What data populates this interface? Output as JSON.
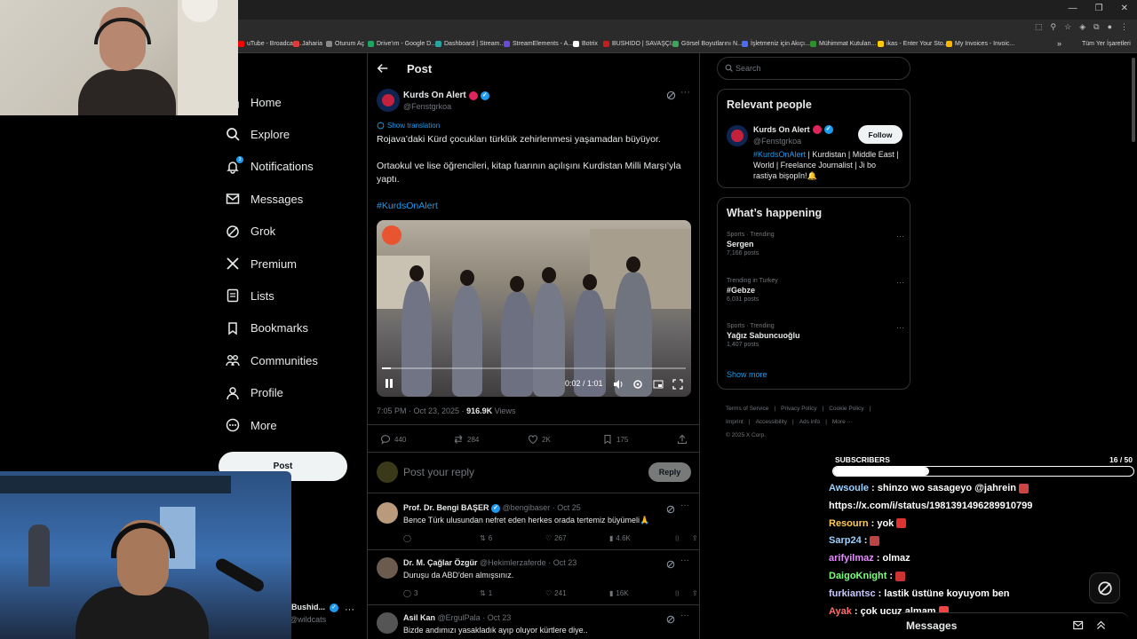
{
  "browser": {
    "bookmarks": [
      {
        "label": "uTube - Broadcas...",
        "color": "#ff0000"
      },
      {
        "label": "Jaharia",
        "color": "#e23a3a"
      },
      {
        "label": "Oturum Aç",
        "color": "#888888"
      },
      {
        "label": "Drive'ım - Google D...",
        "color": "#1fa463"
      },
      {
        "label": "Dashboard | Stream...",
        "color": "#2aa3a3"
      },
      {
        "label": "StreamElements - A...",
        "color": "#6c4bd8"
      },
      {
        "label": "Botrix",
        "color": "#ffffff"
      },
      {
        "label": "BUSHIDO | SAVAŞÇI...",
        "color": "#c81d1d"
      },
      {
        "label": "Görsel Boyutlarını N...",
        "color": "#3ba55c"
      },
      {
        "label": "İşletmeniz için Akıçı...",
        "color": "#4a6cf7"
      },
      {
        "label": "Mühimmat Kutuları...",
        "color": "#2f8f2f"
      },
      {
        "label": "ikas - Enter Your Sto...",
        "color": "#ffcc00"
      },
      {
        "label": "My Invoices - Invoic...",
        "color": "#ffb400"
      }
    ],
    "all_bookmarks": "Tüm Yer İşaretleri"
  },
  "nav": {
    "items": [
      {
        "label": "Home",
        "icon": "home-icon"
      },
      {
        "label": "Explore",
        "icon": "search-icon"
      },
      {
        "label": "Notifications",
        "icon": "bell-icon"
      },
      {
        "label": "Messages",
        "icon": "envelope-icon"
      },
      {
        "label": "Grok",
        "icon": "grok-icon"
      },
      {
        "label": "Premium",
        "icon": "x-logo-icon"
      },
      {
        "label": "Lists",
        "icon": "list-icon"
      },
      {
        "label": "Bookmarks",
        "icon": "bookmark-icon"
      },
      {
        "label": "Communities",
        "icon": "people-icon"
      },
      {
        "label": "Profile",
        "icon": "person-icon"
      },
      {
        "label": "More",
        "icon": "more-circle-icon"
      }
    ],
    "notifications_badge": "3",
    "post_button": "Post",
    "account_name": "Bushid...",
    "account_handle": "@wildcats"
  },
  "post": {
    "header_title": "Post",
    "author_name": "Kurds On Alert",
    "author_handle": "@Fenstgrkoa",
    "show_translation": "Show translation",
    "text_line1": "Rojava’daki Kürd çocukları türklük zehirlenmesi yaşamadan büyüyor.",
    "text_line2": "Ortaokul ve lise öğrencileri, kitap fuarının açılışını Kurdistan Milli Marşı’yla yaptı.",
    "hashtag": "#KurdsOnAlert",
    "video_time": "0:02 / 1:01",
    "video_progress": 0.03,
    "meta_time": "7:05 PM · Oct 23, 2025 · ",
    "meta_views_count": "916.9K",
    "meta_views_label": " Views",
    "replies": "440",
    "reposts": "284",
    "likes": "2K",
    "bookmarks": "175",
    "reply_placeholder": "Post your reply",
    "reply_button": "Reply"
  },
  "replies": [
    {
      "name": "Prof. Dr. Bengi BAŞER",
      "handle": "@bengibaser · Oct 25",
      "text": "Bence Türk ulusundan nefret eden herkes orada tertemiz büyümeli🙏",
      "reposts": "6",
      "likes": "267",
      "views": "4.6K",
      "comments": "",
      "avatar_color": "#b99a7d"
    },
    {
      "name": "Dr. M. Çağlar Özgür",
      "handle": "@Hekimlerzaferde · Oct 23",
      "text": "Duruşu da ABD'den almışsınız.",
      "comments": "3",
      "reposts": "1",
      "likes": "241",
      "views": "16K",
      "avatar_color": "#6b5a4e"
    },
    {
      "name": "Asil Kan",
      "handle": "@ErgulPala · Oct 23",
      "text": "Bizde andımızı yasakladık ayıp oluyor kürtlere diye..",
      "comments": "",
      "reposts": "",
      "likes": "",
      "views": "",
      "avatar_color": "#555555"
    }
  ],
  "sidebar": {
    "search_placeholder": "Search",
    "relevant_title": "Relevant people",
    "rp_name": "Kurds On Alert",
    "rp_handle": "@Fenstgrkoa",
    "follow": "Follow",
    "rp_bio_tag": "#KurdsOnAlert",
    "rp_bio_rest": " | Kurdistan | Middle East | World | Freelance Journalist | Ji bo rastiya bişopîn!🔔",
    "happening_title": "What’s happening",
    "trends": [
      {
        "category": "Sports · Trending",
        "name": "Sergen",
        "count": "7,166 posts"
      },
      {
        "category": "Trending in Turkey",
        "name": "#Gebze",
        "count": "6,031 posts"
      },
      {
        "category": "Sports · Trending",
        "name": "Yağız Sabuncuoğlu",
        "count": "1,407 posts"
      }
    ],
    "show_more": "Show more",
    "footer": [
      "Terms of Service",
      "|",
      "Privacy Policy",
      "|",
      "Cookie Policy",
      "|",
      "Imprint",
      "|",
      "Accessibility",
      "|",
      "Ads info",
      "|",
      "More ···",
      "© 2025 X Corp."
    ]
  },
  "stream": {
    "subscribers_label": "SUBSCRIBERS",
    "subscribers_count": "16  / 50",
    "subscribers_progress": 0.32,
    "chat": [
      {
        "user": "Awsoule",
        "msg": " : shinzo wo sasageyo  @jahrein",
        "color": "#9ad0ff",
        "emote": "#c44"
      },
      {
        "user": "",
        "msg": "https://x.com/i/status/1981391496289910799",
        "color": "#ffffff",
        "emote": ""
      },
      {
        "user": "Resourn",
        "msg": " : yok",
        "color": "#ffcc55",
        "emote": "#d33"
      },
      {
        "user": "Sarp24",
        "msg": " : ",
        "color": "#9ad0ff",
        "emote": "#b44"
      },
      {
        "user": "arifyilmaz",
        "msg": " : olmaz",
        "color": "#e58cff",
        "emote": ""
      },
      {
        "user": "DaigoKnight",
        "msg": " : ",
        "color": "#7dff7d",
        "emote": "#c33"
      },
      {
        "user": "furkiantsc",
        "msg": " : lastik üstüne koyuyom ben",
        "color": "#c8c8ff",
        "emote": ""
      },
      {
        "user": "Ayak",
        "msg": " : çok ucuz almam",
        "color": "#ff6b6b",
        "emote": "#e44"
      }
    ],
    "messages_label": "Messages"
  }
}
